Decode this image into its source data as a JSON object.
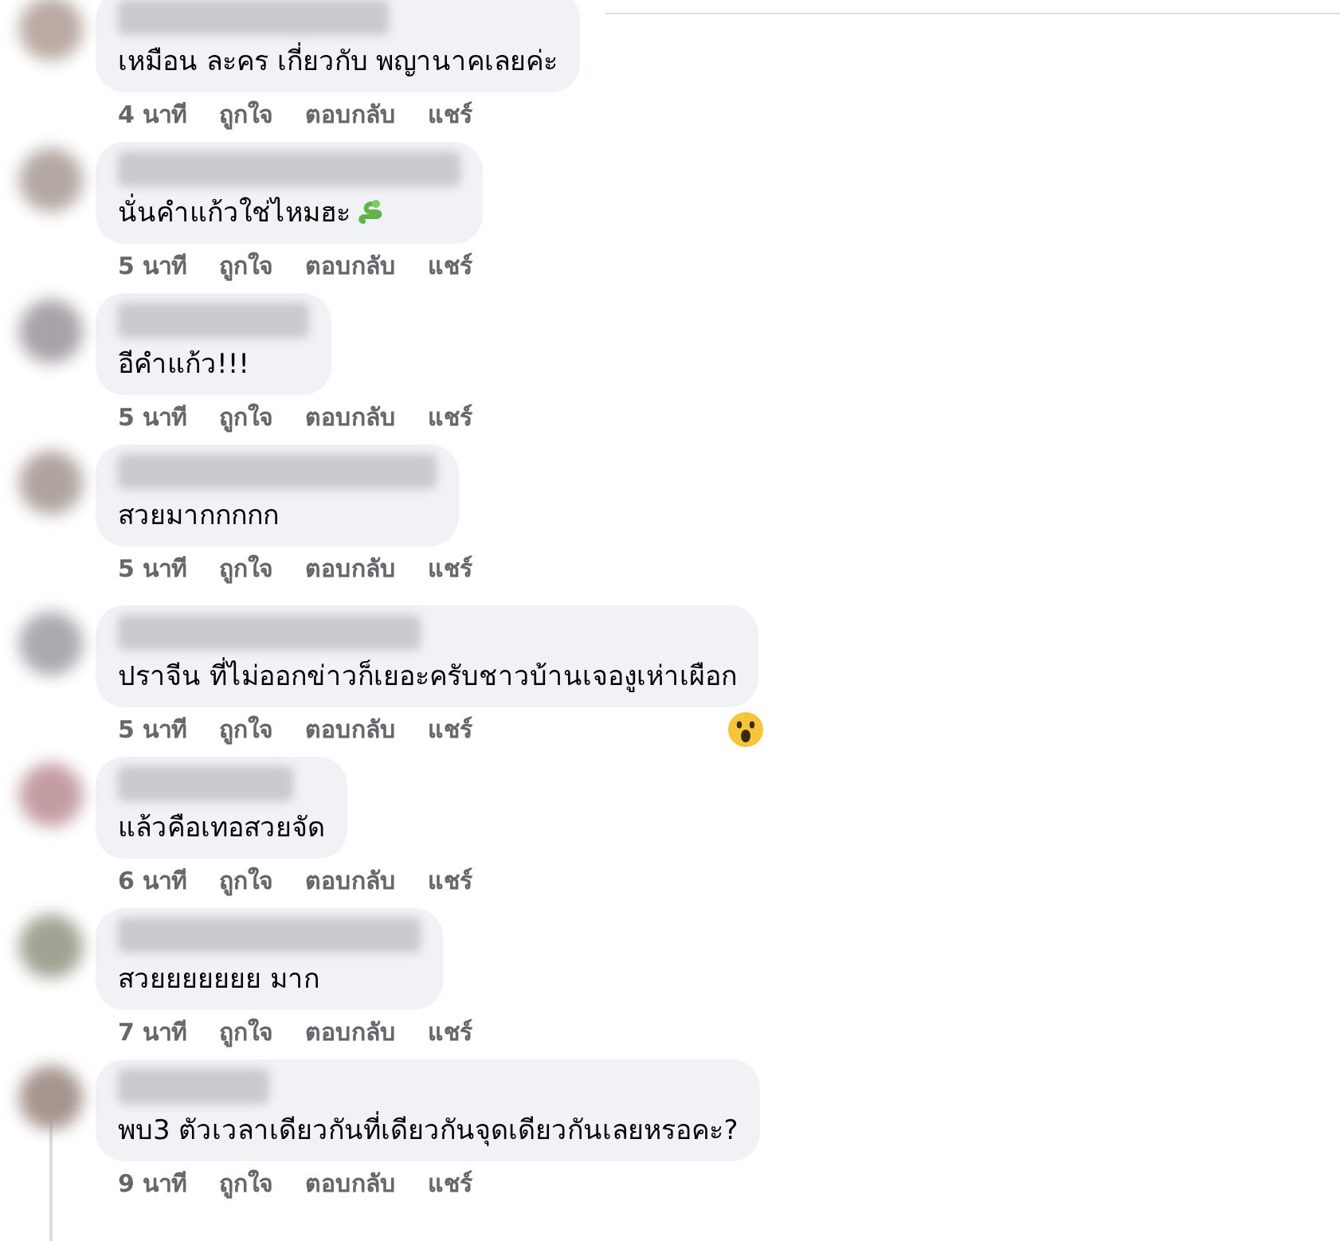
{
  "comments": [
    {
      "text": "เหมือน ละคร เกี่ยวกับ พญานาคเลยค่ะ",
      "time": "4 นาที",
      "actions": [
        "ถูกใจ",
        "ตอบกลับ",
        "แชร์"
      ],
      "has_emoji": false,
      "reaction": false
    },
    {
      "text": "นั่นคำแก้วใช่ไหมฮะ",
      "time": "5 นาที",
      "actions": [
        "ถูกใจ",
        "ตอบกลับ",
        "แชร์"
      ],
      "has_emoji": true,
      "reaction": false
    },
    {
      "text": "อีคำแก้ว!!!",
      "time": "5 นาที",
      "actions": [
        "ถูกใจ",
        "ตอบกลับ",
        "แชร์"
      ],
      "has_emoji": false,
      "reaction": false
    },
    {
      "text": "สวยมากกกกก",
      "time": "5 นาที",
      "actions": [
        "ถูกใจ",
        "ตอบกลับ",
        "แชร์"
      ],
      "has_emoji": false,
      "reaction": false
    },
    {
      "text": "ปราจีน ที่ไม่ออกข่าวก็เยอะครับชาวบ้านเจองูเห่าเผือก",
      "time": "5 นาที",
      "actions": [
        "ถูกใจ",
        "ตอบกลับ",
        "แชร์"
      ],
      "has_emoji": false,
      "reaction": true
    },
    {
      "text": "แล้วคือเทอสวยจัด",
      "time": "6 นาที",
      "actions": [
        "ถูกใจ",
        "ตอบกลับ",
        "แชร์"
      ],
      "has_emoji": false,
      "reaction": false
    },
    {
      "text": "สวยยยยยยย มาก",
      "time": "7 นาที",
      "actions": [
        "ถูกใจ",
        "ตอบกลับ",
        "แชร์"
      ],
      "has_emoji": false,
      "reaction": false
    },
    {
      "text": "พบ3 ตัวเวลาเดียวกันที่เดียวกันจุดเดียวกันเลยหรอคะ?",
      "time": "9 นาที",
      "actions": [
        "ถูกใจ",
        "ตอบกลับ",
        "แชร์"
      ],
      "has_emoji": false,
      "reaction": false
    }
  ]
}
